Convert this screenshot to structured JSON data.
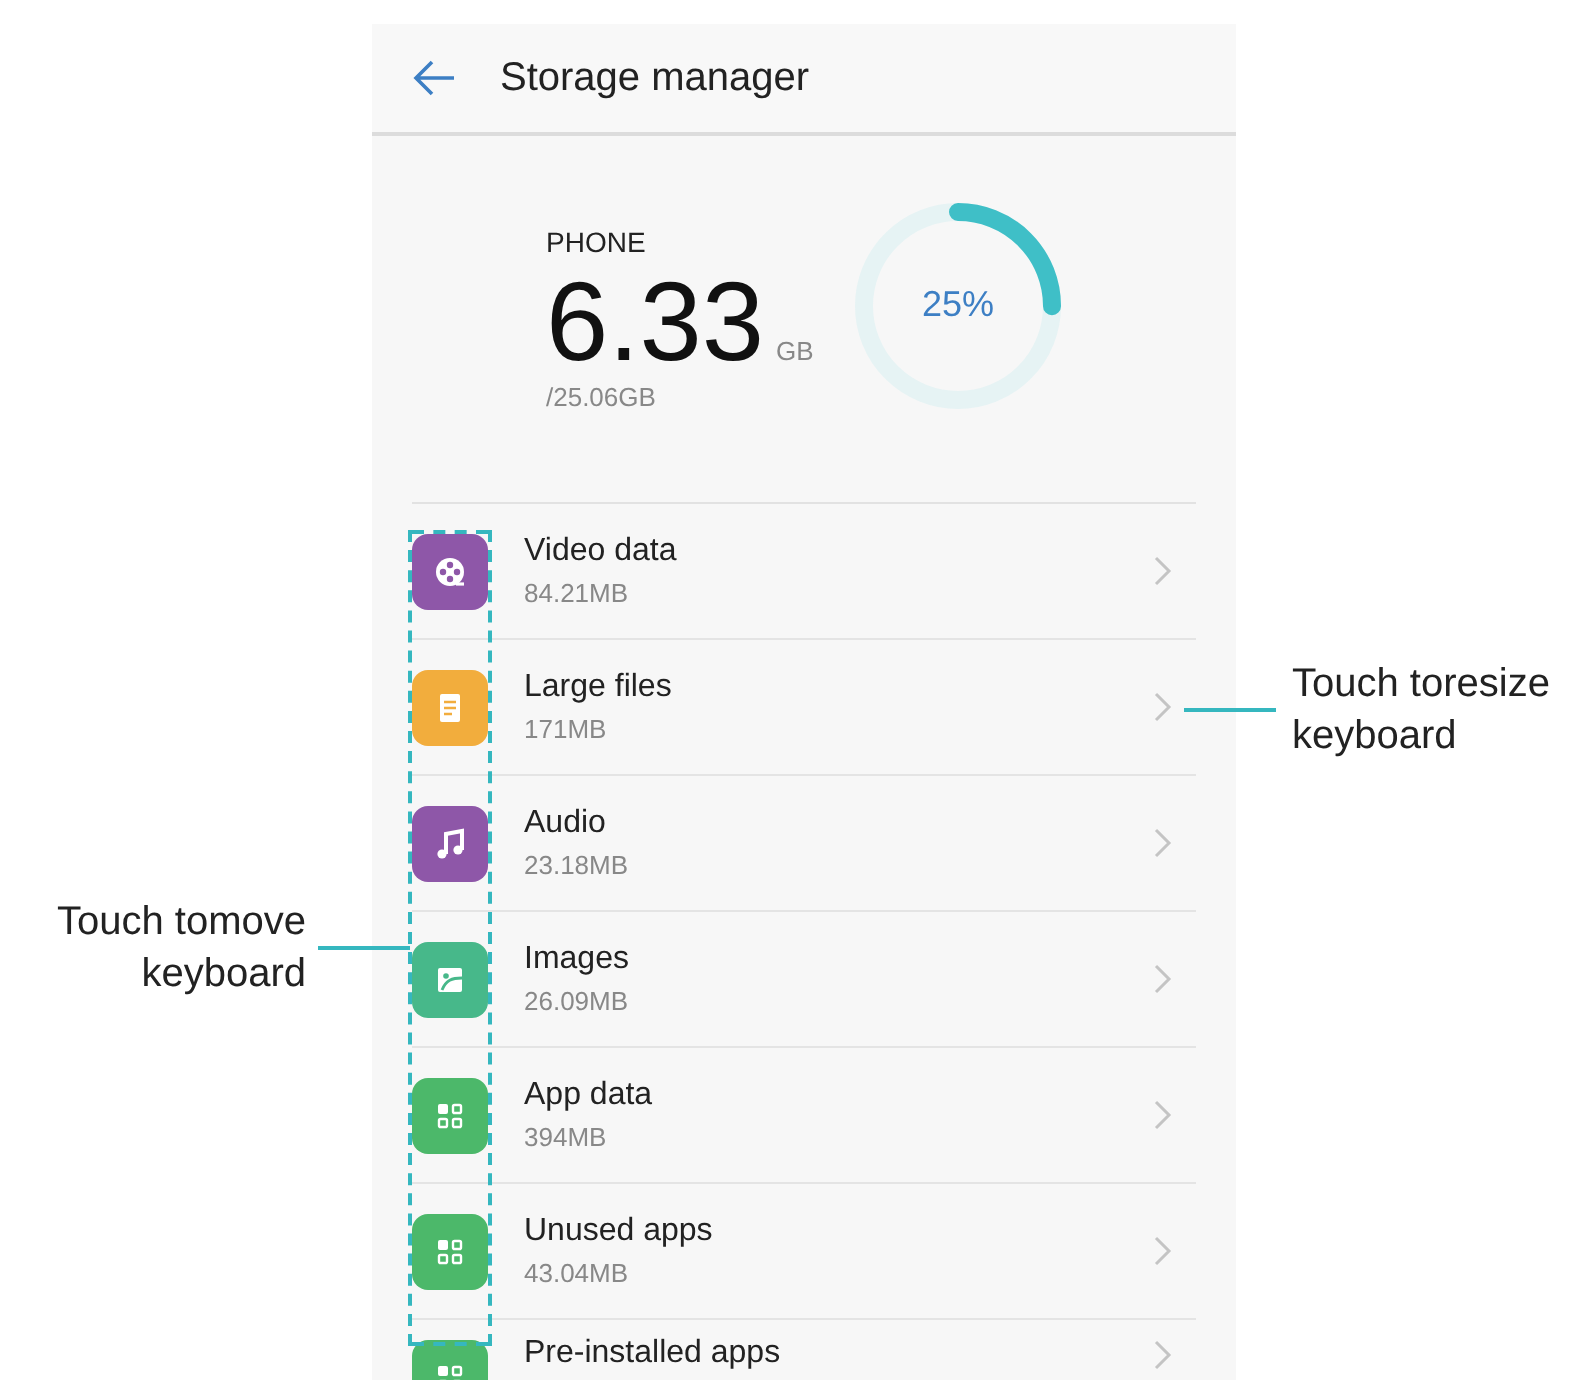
{
  "header": {
    "title": "Storage manager"
  },
  "summary": {
    "label": "PHONE",
    "used": "6.33",
    "unit": "GB",
    "total": "/25.06GB",
    "level": 0.25,
    "reading": "25%"
  },
  "items": [
    {
      "name": "Video data",
      "size": "84.21MB",
      "kind": "video",
      "color": "#8e57a8"
    },
    {
      "name": "Large files",
      "size": "171MB",
      "kind": "document",
      "color": "#f2ad3d"
    },
    {
      "name": "Audio",
      "size": "23.18MB",
      "kind": "music",
      "color": "#8e57a8"
    },
    {
      "name": "Images",
      "size": "26.09MB",
      "kind": "image",
      "color": "#47b88a"
    },
    {
      "name": "App data",
      "size": "394MB",
      "kind": "apps",
      "color": "#4cb86a"
    },
    {
      "name": "Unused apps",
      "size": "43.04MB",
      "kind": "apps",
      "color": "#4cb86a"
    },
    {
      "name": "Pre-installed apps",
      "kind": "apps",
      "color": "#4cb86a"
    }
  ],
  "callouts": [
    {
      "kind": "right",
      "text": "Touch toresize keyboard"
    },
    {
      "kind": "left",
      "text": "Touch tomove keyboard"
    }
  ]
}
